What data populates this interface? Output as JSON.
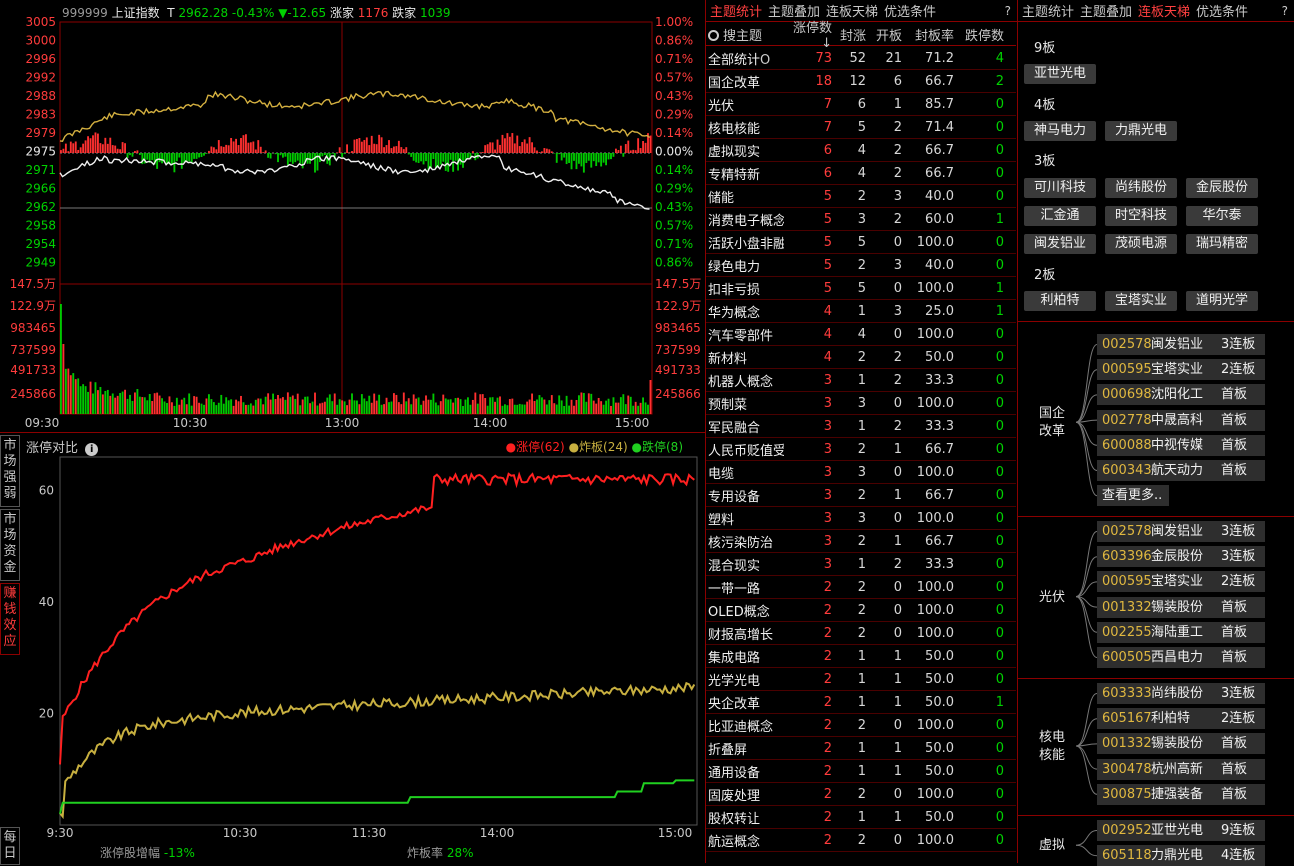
{
  "index": {
    "code": "999999",
    "name": "上证指数",
    "t": "T",
    "price": "2962.28",
    "pct": "-0.43%",
    "chg": "▼-12.65",
    "up_label": "涨家",
    "up": "1176",
    "down_label": "跌家",
    "down": "1039"
  },
  "colors": {
    "up": "#ff3c3c",
    "down": "#00d200",
    "flat": "#e8e8e8",
    "yellow": "#d4b040",
    "border": "#8b0000"
  },
  "price_axis": {
    "left": [
      "3005",
      "3000",
      "2996",
      "2992",
      "2988",
      "2983",
      "2979",
      "2975",
      "2971",
      "2966",
      "2962",
      "2958",
      "2954",
      "2949"
    ],
    "right": [
      "1.00%",
      "0.86%",
      "0.71%",
      "0.57%",
      "0.43%",
      "0.29%",
      "0.14%",
      "0.00%",
      "0.14%",
      "0.29%",
      "0.43%",
      "0.57%",
      "0.71%",
      "0.86%"
    ]
  },
  "vol_axis": {
    "left": [
      "147.5万",
      "122.9万",
      "983465",
      "737599",
      "491733",
      "245866"
    ],
    "right": [
      "147.5万",
      "122.9万",
      "983465",
      "737599",
      "491733",
      "245866"
    ]
  },
  "time_axis": [
    "09:30",
    "10:30",
    "13:00",
    "14:00",
    "15:00"
  ],
  "compare": {
    "title": "涨停对比",
    "info_icon": "info-icon",
    "legend": [
      {
        "label": "涨停(62)",
        "color": "#ff2020"
      },
      {
        "label": "炸板(24)",
        "color": "#c8b040"
      },
      {
        "label": "跌停(8)",
        "color": "#20d020"
      }
    ],
    "yticks": [
      "60",
      "40",
      "20"
    ],
    "xticks": [
      "9:30",
      "10:30",
      "11:30",
      "14:00",
      "15:00"
    ],
    "footer_left_label": "涨停股增幅",
    "footer_left_val": "-13%",
    "footer_right_label": "炸板率",
    "footer_right_val": "28%"
  },
  "side_tabs": [
    "市场强弱",
    "市场资金",
    "赚钱效应",
    "每日"
  ],
  "mid_tabs": [
    "主题统计",
    "主题叠加",
    "连板天梯",
    "优选条件",
    "?"
  ],
  "right_tabs": [
    "主题统计",
    "主题叠加",
    "连板天梯",
    "优选条件",
    "?"
  ],
  "table": {
    "search": "搜主题",
    "headers": [
      "涨停数↓",
      "封涨",
      "开板",
      "封板率",
      "跌停数"
    ],
    "rows": [
      [
        "全部统计",
        "73",
        "52",
        "21",
        "71.2",
        "4"
      ],
      [
        "国企改革",
        "18",
        "12",
        "6",
        "66.7",
        "2"
      ],
      [
        "光伏",
        "7",
        "6",
        "1",
        "85.7",
        "0"
      ],
      [
        "核电核能",
        "7",
        "5",
        "2",
        "71.4",
        "0"
      ],
      [
        "虚拟现实",
        "6",
        "4",
        "2",
        "66.7",
        "0"
      ],
      [
        "专精特新",
        "6",
        "4",
        "2",
        "66.7",
        "0"
      ],
      [
        "储能",
        "5",
        "2",
        "3",
        "40.0",
        "0"
      ],
      [
        "消费电子概念",
        "5",
        "3",
        "2",
        "60.0",
        "1"
      ],
      [
        "活跃小盘非融",
        "5",
        "5",
        "0",
        "100.0",
        "0"
      ],
      [
        "绿色电力",
        "5",
        "2",
        "3",
        "40.0",
        "0"
      ],
      [
        "扣非亏损",
        "5",
        "5",
        "0",
        "100.0",
        "1"
      ],
      [
        "华为概念",
        "4",
        "1",
        "3",
        "25.0",
        "1"
      ],
      [
        "汽车零部件",
        "4",
        "4",
        "0",
        "100.0",
        "0"
      ],
      [
        "新材料",
        "4",
        "2",
        "2",
        "50.0",
        "0"
      ],
      [
        "机器人概念",
        "3",
        "1",
        "2",
        "33.3",
        "0"
      ],
      [
        "预制菜",
        "3",
        "3",
        "0",
        "100.0",
        "0"
      ],
      [
        "军民融合",
        "3",
        "1",
        "2",
        "33.3",
        "0"
      ],
      [
        "人民币贬值受益",
        "3",
        "2",
        "1",
        "66.7",
        "0"
      ],
      [
        "电缆",
        "3",
        "3",
        "0",
        "100.0",
        "0"
      ],
      [
        "专用设备",
        "3",
        "2",
        "1",
        "66.7",
        "0"
      ],
      [
        "塑料",
        "3",
        "3",
        "0",
        "100.0",
        "0"
      ],
      [
        "核污染防治",
        "3",
        "2",
        "1",
        "66.7",
        "0"
      ],
      [
        "混合现实",
        "3",
        "1",
        "2",
        "33.3",
        "0"
      ],
      [
        "一带一路",
        "2",
        "2",
        "0",
        "100.0",
        "0"
      ],
      [
        "OLED概念",
        "2",
        "2",
        "0",
        "100.0",
        "0"
      ],
      [
        "财报高增长",
        "2",
        "2",
        "0",
        "100.0",
        "0"
      ],
      [
        "集成电路",
        "2",
        "1",
        "1",
        "50.0",
        "0"
      ],
      [
        "光学光电",
        "2",
        "1",
        "1",
        "50.0",
        "0"
      ],
      [
        "央企改革",
        "2",
        "1",
        "1",
        "50.0",
        "1"
      ],
      [
        "比亚迪概念",
        "2",
        "2",
        "0",
        "100.0",
        "0"
      ],
      [
        "折叠屏",
        "2",
        "1",
        "1",
        "50.0",
        "0"
      ],
      [
        "通用设备",
        "2",
        "1",
        "1",
        "50.0",
        "0"
      ],
      [
        "固废处理",
        "2",
        "2",
        "0",
        "100.0",
        "0"
      ],
      [
        "股权转让",
        "2",
        "1",
        "1",
        "50.0",
        "0"
      ],
      [
        "航运概念",
        "2",
        "2",
        "0",
        "100.0",
        "0"
      ]
    ]
  },
  "ladder": {
    "b9": "9板",
    "b9_items": [
      "亚世光电"
    ],
    "b4": "4板",
    "b4_items": [
      "神马电力",
      "力鼎光电"
    ],
    "b3": "3板",
    "b3_items": [
      "可川科技",
      "尚纬股份",
      "金辰股份",
      "汇金通",
      "时空科技",
      "华尔泰",
      "闽发铝业",
      "茂硕电源",
      "瑞玛精密"
    ],
    "b2": "2板",
    "b2_items": [
      "利柏特",
      "宝塔实业",
      "道明光学"
    ]
  },
  "themes": [
    {
      "name": "国企改革",
      "items": [
        [
          "002578",
          "闽发铝业",
          "3连板"
        ],
        [
          "000595",
          "宝塔实业",
          "2连板"
        ],
        [
          "000698",
          "沈阳化工",
          "首板"
        ],
        [
          "002778",
          "中晟高科",
          "首板"
        ],
        [
          "600088",
          "中视传媒",
          "首板"
        ],
        [
          "600343",
          "航天动力",
          "首板"
        ]
      ],
      "more": "查看更多.."
    },
    {
      "name": "光伏",
      "items": [
        [
          "002578",
          "闽发铝业",
          "3连板"
        ],
        [
          "603396",
          "金辰股份",
          "3连板"
        ],
        [
          "000595",
          "宝塔实业",
          "2连板"
        ],
        [
          "001332",
          "锡装股份",
          "首板"
        ],
        [
          "002255",
          "海陆重工",
          "首板"
        ],
        [
          "600505",
          "西昌电力",
          "首板"
        ]
      ]
    },
    {
      "name": "核电核能",
      "items": [
        [
          "603333",
          "尚纬股份",
          "3连板"
        ],
        [
          "605167",
          "利柏特",
          "2连板"
        ],
        [
          "001332",
          "锡装股份",
          "首板"
        ],
        [
          "300478",
          "杭州高新",
          "首板"
        ],
        [
          "300875",
          "捷强装备",
          "首板"
        ]
      ]
    },
    {
      "name": "虚拟",
      "items": [
        [
          "002952",
          "亚世光电",
          "9连板"
        ],
        [
          "605118",
          "力鼎光电",
          "4连板"
        ]
      ]
    }
  ]
}
